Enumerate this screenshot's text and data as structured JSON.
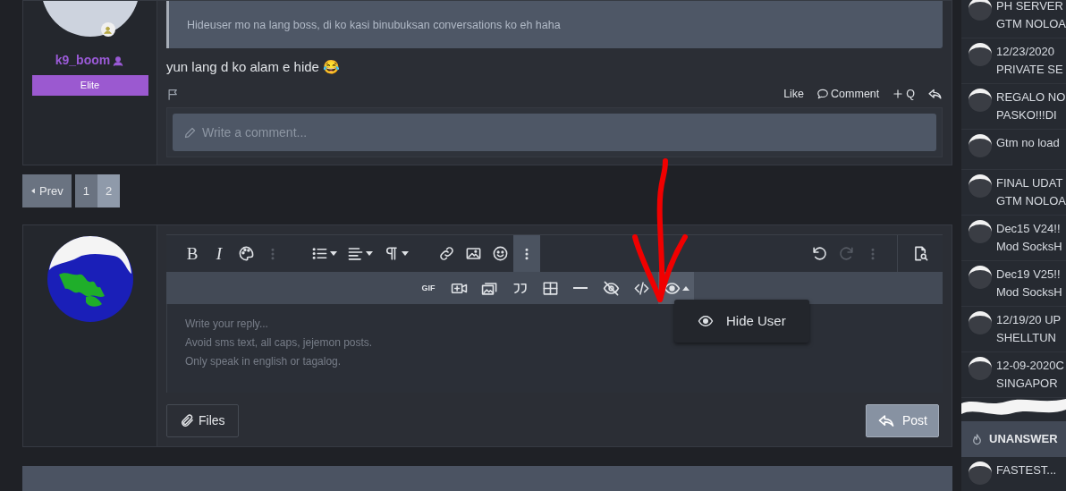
{
  "post": {
    "username": "k9_boom",
    "badge": "Elite",
    "quote": "Hideuser mo na lang boss, di ko kasi binubuksan conversations ko eh haha",
    "message": "yun lang d ko alam e hide",
    "emoji": "😂",
    "actions": [
      {
        "kind": "like",
        "label": "Like"
      },
      {
        "kind": "comment",
        "label": "Comment"
      },
      {
        "kind": "multiquote",
        "label": "Q"
      }
    ],
    "comment_placeholder": "Write a comment..."
  },
  "pagination": {
    "prev": "Prev",
    "pages": [
      {
        "label": "1",
        "selected": false
      },
      {
        "label": "2",
        "selected": true
      }
    ]
  },
  "editor": {
    "toolbar_top": [
      {
        "kind": "bold",
        "label": "B",
        "active": false,
        "disabled": false,
        "dropdown": false
      },
      {
        "kind": "italic",
        "label": "I",
        "active": false,
        "disabled": false,
        "dropdown": false
      },
      {
        "kind": "palette",
        "active": false,
        "disabled": false,
        "dropdown": false
      },
      {
        "kind": "more",
        "active": false,
        "disabled": true,
        "dropdown": false
      },
      {
        "kind": "gap"
      },
      {
        "kind": "list",
        "active": false,
        "disabled": false,
        "dropdown": true
      },
      {
        "kind": "align",
        "active": false,
        "disabled": false,
        "dropdown": true
      },
      {
        "kind": "paragraph",
        "active": false,
        "disabled": false,
        "dropdown": true
      },
      {
        "kind": "gap"
      },
      {
        "kind": "link",
        "active": false,
        "disabled": false,
        "dropdown": false
      },
      {
        "kind": "image",
        "active": false,
        "disabled": false,
        "dropdown": false
      },
      {
        "kind": "smile",
        "active": false,
        "disabled": false,
        "dropdown": false
      },
      {
        "kind": "more",
        "active": true,
        "disabled": false,
        "dropdown": false
      },
      {
        "kind": "spacer"
      },
      {
        "kind": "undo",
        "active": false,
        "disabled": false,
        "dropdown": false
      },
      {
        "kind": "redo",
        "active": false,
        "disabled": true,
        "dropdown": false
      },
      {
        "kind": "more",
        "active": false,
        "disabled": true,
        "dropdown": false
      },
      {
        "kind": "divider"
      },
      {
        "kind": "preview",
        "active": false,
        "disabled": false,
        "dropdown": false
      }
    ],
    "toolbar_bottom": [
      {
        "kind": "gif",
        "label": "GIF",
        "active": false,
        "disabled": false,
        "dropdown": false
      },
      {
        "kind": "video",
        "active": false,
        "disabled": false,
        "dropdown": false
      },
      {
        "kind": "gallery",
        "active": false,
        "disabled": false,
        "dropdown": false
      },
      {
        "kind": "quote",
        "active": false,
        "disabled": false,
        "dropdown": false
      },
      {
        "kind": "table",
        "active": false,
        "disabled": false,
        "dropdown": false
      },
      {
        "kind": "rule",
        "active": false,
        "disabled": false,
        "dropdown": false
      },
      {
        "kind": "eyeslash",
        "active": false,
        "disabled": false,
        "dropdown": false
      },
      {
        "kind": "code",
        "active": false,
        "disabled": false,
        "dropdown": false
      },
      {
        "kind": "eye",
        "active": true,
        "disabled": false,
        "dropdown": true
      }
    ],
    "menu": [
      {
        "kind": "eye",
        "label": "Hide User"
      }
    ],
    "placeholder_lines": [
      "Write your reply...",
      "Avoid sms text, all caps, jejemon posts.",
      "Only speak in english or tagalog."
    ],
    "files_button": "Files",
    "post_button": "Post"
  },
  "sidebar": {
    "threads": [
      {
        "lines": [
          "PH SERVER",
          "GTM NOLOA"
        ]
      },
      {
        "lines": [
          "12/23/2020",
          "PRIVATE SE"
        ]
      },
      {
        "lines": [
          "REGALO NO",
          "PASKO!!!DI"
        ]
      },
      {
        "lines": [
          "Gtm no load"
        ]
      },
      {
        "lines": [
          "FINAL UDAT",
          "GTM NOLOA"
        ]
      },
      {
        "lines": [
          "Dec15 V24!!",
          "Mod SocksH"
        ]
      },
      {
        "lines": [
          "Dec19 V25!!",
          "Mod SocksH"
        ]
      },
      {
        "lines": [
          "12/19/20 UP",
          "SHELLTUN"
        ]
      },
      {
        "lines": [
          "12-09-2020C",
          "SINGAPOR"
        ]
      }
    ],
    "section_title": "UNANSWER",
    "section_threads": [
      {
        "lines": [
          "FASTEST..."
        ]
      }
    ]
  }
}
